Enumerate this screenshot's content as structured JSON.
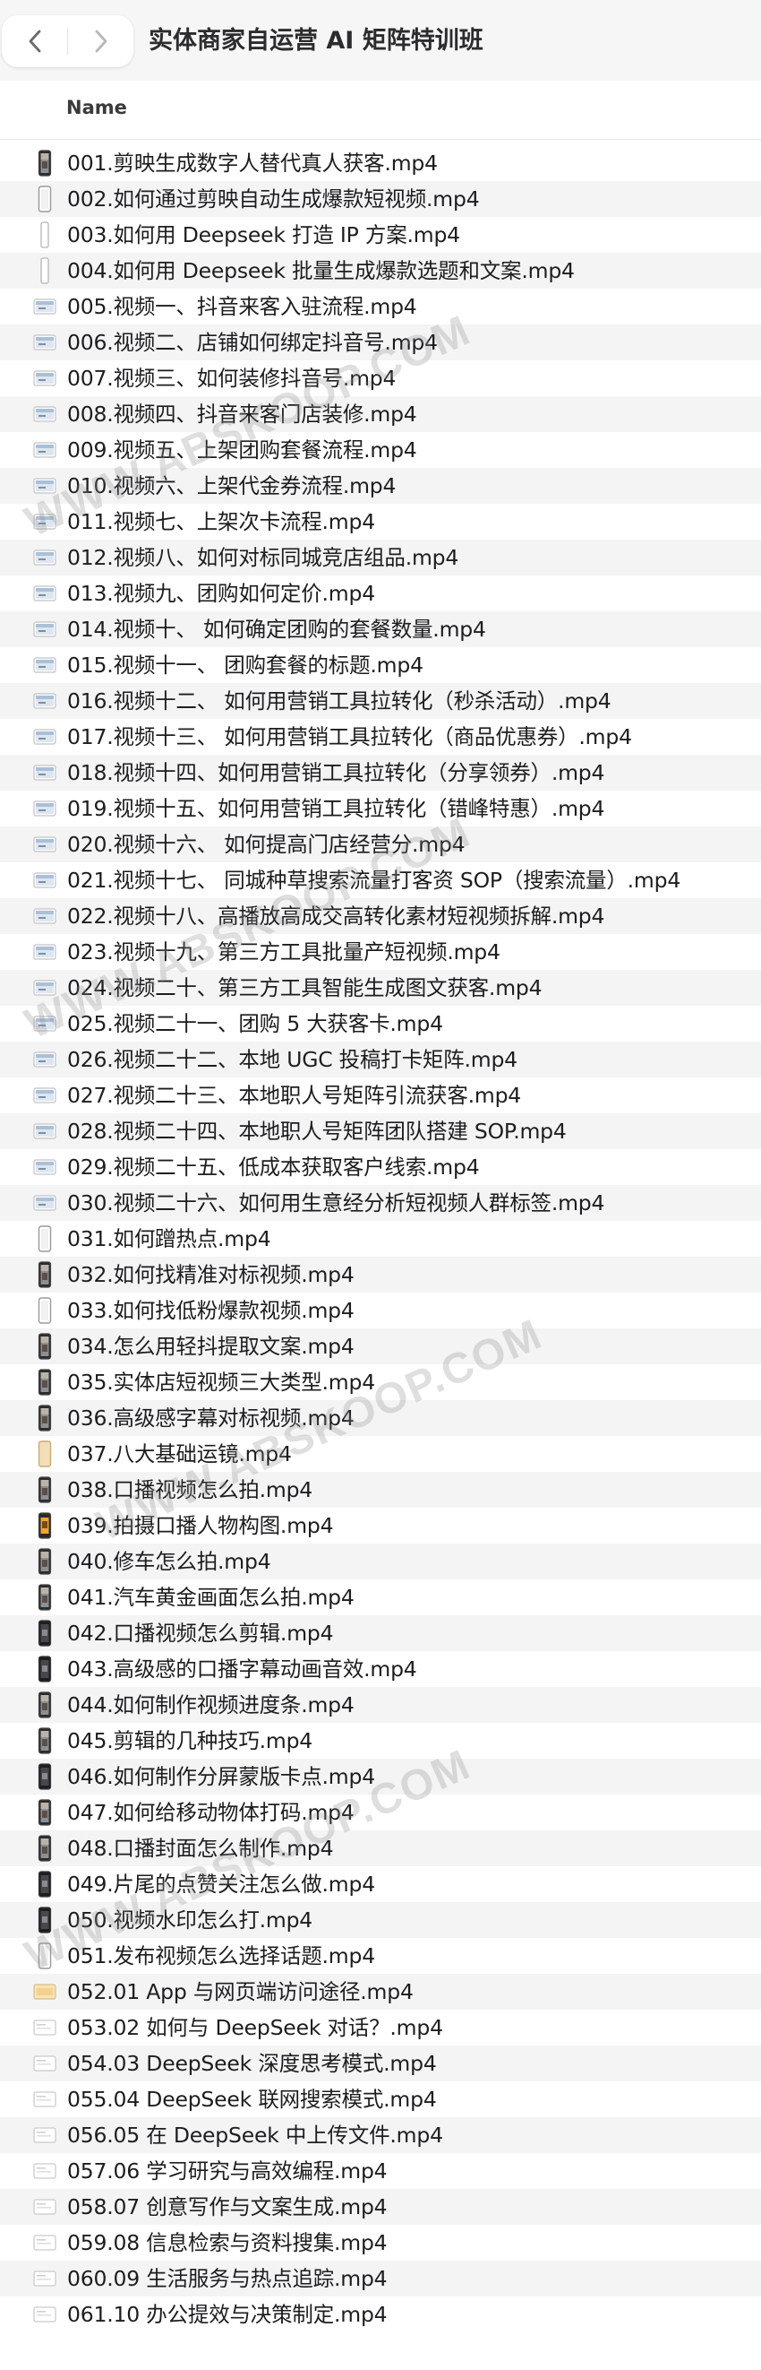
{
  "window": {
    "title": "实体商家自运营 AI 矩阵特训班",
    "back_icon": "chevron-left-icon",
    "forward_icon": "chevron-right-icon"
  },
  "list_header": {
    "name_label": "Name"
  },
  "watermark": "WWW.ABSKOOP.COM",
  "files": [
    {
      "name": "001.剪映生成数字人替代真人获客.mp4",
      "icon": "phone-video"
    },
    {
      "name": "002.如何通过剪映自动生成爆款短视频.mp4",
      "icon": "phone-blank"
    },
    {
      "name": "003.如何用 Deepseek 打造 IP 方案.mp4",
      "icon": "phone-thin"
    },
    {
      "name": "004.如何用 Deepseek 批量生成爆款选题和文案.mp4",
      "icon": "phone-thin"
    },
    {
      "name": "005.视频一、抖音来客入驻流程.mp4",
      "icon": "landscape-video"
    },
    {
      "name": "006.视频二、店铺如何绑定抖音号.mp4",
      "icon": "landscape-video"
    },
    {
      "name": "007.视频三、如何装修抖音号.mp4",
      "icon": "landscape-video"
    },
    {
      "name": "008.视频四、抖音来客门店装修.mp4",
      "icon": "landscape-video"
    },
    {
      "name": "009.视频五、上架团购套餐流程.mp4",
      "icon": "landscape-video"
    },
    {
      "name": "010.视频六、上架代金券流程.mp4",
      "icon": "landscape-video"
    },
    {
      "name": "011.视频七、上架次卡流程.mp4",
      "icon": "landscape-video"
    },
    {
      "name": "012.视频八、如何对标同城竞店组品.mp4",
      "icon": "landscape-video"
    },
    {
      "name": "013.视频九、团购如何定价.mp4",
      "icon": "landscape-video"
    },
    {
      "name": "014.视频十、 如何确定团购的套餐数量.mp4",
      "icon": "landscape-video"
    },
    {
      "name": "015.视频十一、 团购套餐的标题.mp4",
      "icon": "landscape-video"
    },
    {
      "name": "016.视频十二、 如何用营销工具拉转化（秒杀活动）.mp4",
      "icon": "landscape-video"
    },
    {
      "name": "017.视频十三、 如何用营销工具拉转化（商品优惠券）.mp4",
      "icon": "landscape-video"
    },
    {
      "name": "018.视频十四、如何用营销工具拉转化（分享领券）.mp4",
      "icon": "landscape-video"
    },
    {
      "name": "019.视频十五、如何用营销工具拉转化（错峰特惠）.mp4",
      "icon": "landscape-video"
    },
    {
      "name": "020.视频十六、 如何提高门店经营分.mp4",
      "icon": "landscape-video"
    },
    {
      "name": "021.视频十七、 同城种草搜索流量打客资 SOP（搜索流量）.mp4",
      "icon": "landscape-video"
    },
    {
      "name": "022.视频十八、高播放高成交高转化素材短视频拆解.mp4",
      "icon": "landscape-video"
    },
    {
      "name": "023.视频十九、第三方工具批量产短视频.mp4",
      "icon": "landscape-video"
    },
    {
      "name": "024.视频二十、第三方工具智能生成图文获客.mp4",
      "icon": "landscape-video"
    },
    {
      "name": "025.视频二十一、团购 5 大获客卡.mp4",
      "icon": "landscape-video"
    },
    {
      "name": "026.视频二十二、本地 UGC 投稿打卡矩阵.mp4",
      "icon": "landscape-video"
    },
    {
      "name": "027.视频二十三、本地职人号矩阵引流获客.mp4",
      "icon": "landscape-video"
    },
    {
      "name": "028.视频二十四、本地职人号矩阵团队搭建 SOP.mp4",
      "icon": "landscape-video"
    },
    {
      "name": "029.视频二十五、低成本获取客户线索.mp4",
      "icon": "landscape-video"
    },
    {
      "name": "030.视频二十六、如何用生意经分析短视频人群标签.mp4",
      "icon": "landscape-video"
    },
    {
      "name": "031.如何蹭热点.mp4",
      "icon": "phone-blank"
    },
    {
      "name": "032.如何找精准对标视频.mp4",
      "icon": "phone-video"
    },
    {
      "name": "033.如何找低粉爆款视频.mp4",
      "icon": "phone-blank"
    },
    {
      "name": "034.怎么用轻抖提取文案.mp4",
      "icon": "phone-video"
    },
    {
      "name": "035.实体店短视频三大类型.mp4",
      "icon": "phone-video"
    },
    {
      "name": "036.高级感字幕对标视频.mp4",
      "icon": "phone-video"
    },
    {
      "name": "037.八大基础运镜.mp4",
      "icon": "phone-beige"
    },
    {
      "name": "038.口播视频怎么拍.mp4",
      "icon": "phone-video"
    },
    {
      "name": "039.拍摄口播人物构图.mp4",
      "icon": "phone-orange"
    },
    {
      "name": "040.修车怎么拍.mp4",
      "icon": "phone-video"
    },
    {
      "name": "041.汽车黄金画面怎么拍.mp4",
      "icon": "phone-video"
    },
    {
      "name": "042.口播视频怎么剪辑.mp4",
      "icon": "phone-dark"
    },
    {
      "name": "043.高级感的口播字幕动画音效.mp4",
      "icon": "phone-dark"
    },
    {
      "name": "044.如何制作视频进度条.mp4",
      "icon": "phone-video"
    },
    {
      "name": "045.剪辑的几种技巧.mp4",
      "icon": "phone-video"
    },
    {
      "name": "046.如何制作分屏蒙版卡点.mp4",
      "icon": "phone-dark"
    },
    {
      "name": "047.如何给移动物体打码.mp4",
      "icon": "phone-video"
    },
    {
      "name": "048.口播封面怎么制作.mp4",
      "icon": "phone-video"
    },
    {
      "name": "049.片尾的点赞关注怎么做.mp4",
      "icon": "phone-dark"
    },
    {
      "name": "050.视频水印怎么打.mp4",
      "icon": "phone-dark"
    },
    {
      "name": "051.发布视频怎么选择话题.mp4",
      "icon": "phone-blank"
    },
    {
      "name": "052.01 App 与网页端访问途径.mp4",
      "icon": "landscape-beige"
    },
    {
      "name": "053.02 如何与 DeepSeek 对话？.mp4",
      "icon": "landscape-white"
    },
    {
      "name": "054.03 DeepSeek 深度思考模式.mp4",
      "icon": "landscape-white"
    },
    {
      "name": "055.04 DeepSeek 联网搜索模式.mp4",
      "icon": "landscape-white"
    },
    {
      "name": "056.05 在 DeepSeek 中上传文件.mp4",
      "icon": "landscape-white"
    },
    {
      "name": "057.06 学习研究与高效编程.mp4",
      "icon": "landscape-white"
    },
    {
      "name": "058.07 创意写作与文案生成.mp4",
      "icon": "landscape-white"
    },
    {
      "name": "059.08 信息检索与资料搜集.mp4",
      "icon": "landscape-white"
    },
    {
      "name": "060.09 生活服务与热点追踪.mp4",
      "icon": "landscape-white"
    },
    {
      "name": "061.10 办公提效与决策制定.mp4",
      "icon": "landscape-white"
    }
  ]
}
